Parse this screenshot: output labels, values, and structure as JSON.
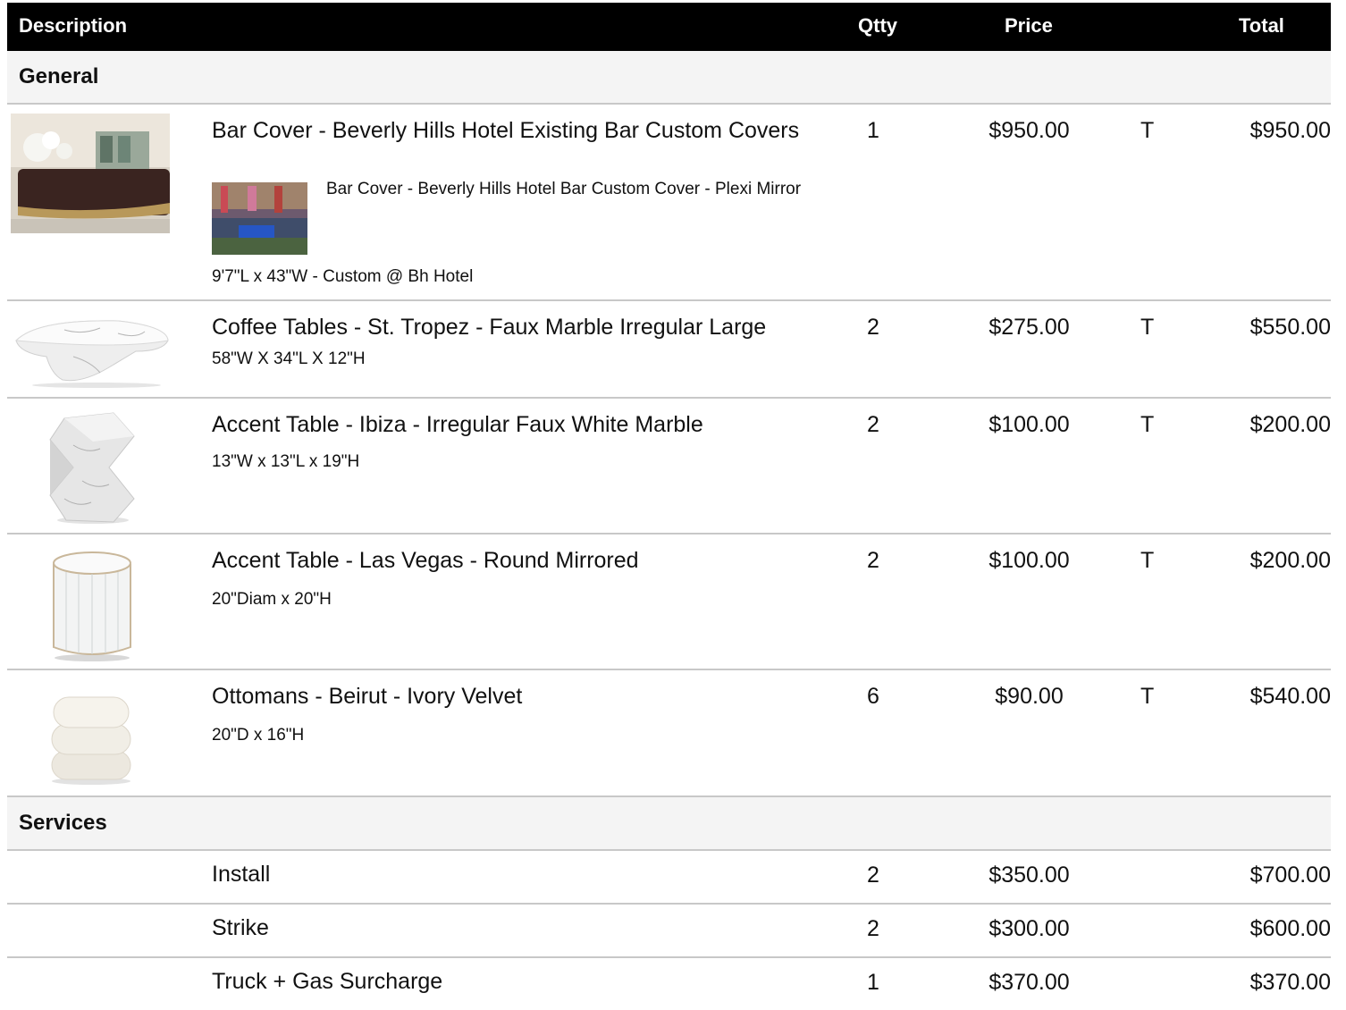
{
  "header": {
    "description": "Description",
    "qty": "Qtty",
    "price": "Price",
    "total": "Total"
  },
  "sections": {
    "general": "General",
    "services": "Services"
  },
  "items": [
    {
      "title": "Bar Cover  - Beverly Hills Hotel Existing Bar Custom Covers",
      "sub_title": "Bar Cover - Beverly Hills Hotel Bar Custom Cover - Plexi Mirror",
      "spec": "9'7\"L x 43\"W - Custom @ Bh Hotel",
      "qty": "1",
      "price": "$950.00",
      "tax": "T",
      "total": "$950.00"
    },
    {
      "title": "Coffee Tables - St. Tropez - Faux Marble Irregular Large",
      "spec": "58\"W X 34\"L X 12\"H",
      "qty": "2",
      "price": "$275.00",
      "tax": "T",
      "total": "$550.00"
    },
    {
      "title": "Accent Table - Ibiza - Irregular Faux White Marble",
      "spec": "13\"W x 13\"L x 19\"H",
      "qty": "2",
      "price": "$100.00",
      "tax": "T",
      "total": "$200.00"
    },
    {
      "title": "Accent Table - Las Vegas - Round Mirrored",
      "spec": "20\"Diam x 20\"H",
      "qty": "2",
      "price": "$100.00",
      "tax": "T",
      "total": "$200.00"
    },
    {
      "title": "Ottomans - Beirut - Ivory Velvet",
      "spec": "20\"D x 16\"H",
      "qty": "6",
      "price": "$90.00",
      "tax": "T",
      "total": "$540.00"
    }
  ],
  "services": [
    {
      "name": "Install",
      "qty": "2",
      "price": "$350.00",
      "total": "$700.00"
    },
    {
      "name": "Strike",
      "qty": "2",
      "price": "$300.00",
      "total": "$600.00"
    },
    {
      "name": "Truck + Gas Surcharge",
      "qty": "1",
      "price": "$370.00",
      "total": "$370.00"
    }
  ]
}
